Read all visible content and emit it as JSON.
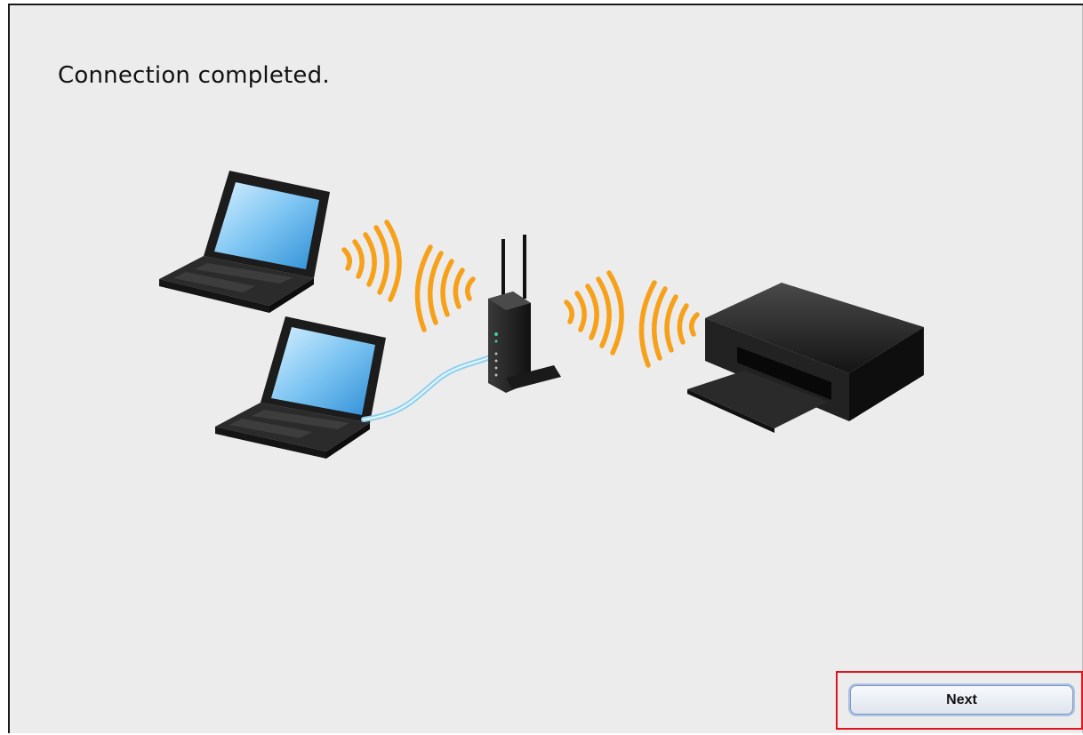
{
  "page": {
    "title": "Connection completed."
  },
  "illustration": {
    "devices": [
      "laptop-icon",
      "laptop-icon",
      "wireless-router-icon",
      "printer-icon"
    ],
    "signal_color": "#f7a11a",
    "cable_color": "#8fd0ee"
  },
  "footer": {
    "next_label": "Next",
    "highlight_color": "#e0141e"
  }
}
